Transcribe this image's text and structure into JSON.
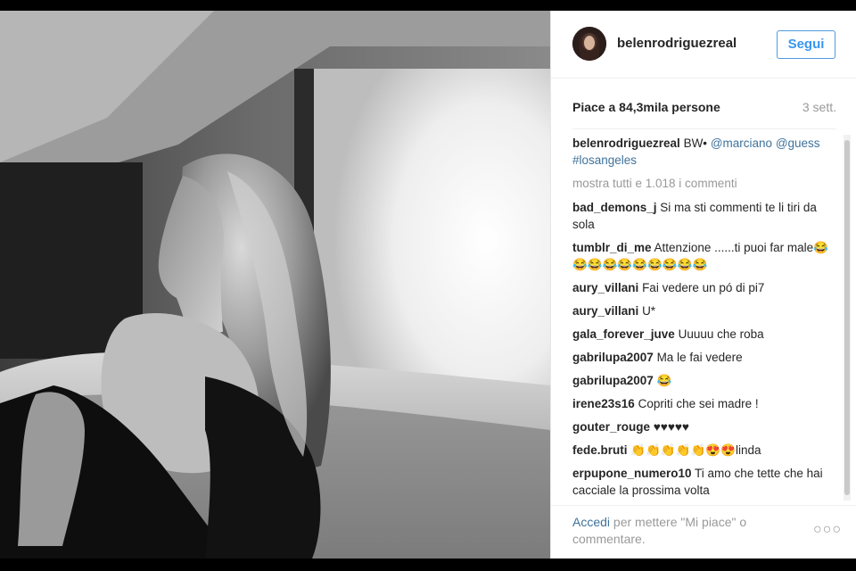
{
  "post": {
    "username": "belenrodriguezreal",
    "follow_label": "Segui",
    "likes": "Piace a 84,3mila persone",
    "time_ago": "3 sett.",
    "caption": {
      "user": "belenrodriguezreal",
      "text": "BW•",
      "tags": [
        "@marciano",
        "@guess",
        "#losangeles"
      ]
    },
    "show_all": "mostra tutti e 1.018 i commenti",
    "comments": [
      {
        "user": "bad_demons_j",
        "text": "Si ma sti commenti te li tiri da sola"
      },
      {
        "user": "tumblr_di_me",
        "text": "Attenzione ......ti puoi far male😂😂😂😂😂😂😂😂😂😂"
      },
      {
        "user": "aury_villani",
        "text": "Fai vedere un pó di pi7"
      },
      {
        "user": "aury_villani",
        "text": "U*"
      },
      {
        "user": "gala_forever_juve",
        "text": "Uuuuu che roba"
      },
      {
        "user": "gabrilupa2007",
        "text": "Ma le fai vedere"
      },
      {
        "user": "gabrilupa2007",
        "text": "😂"
      },
      {
        "user": "irene23s16",
        "text": "Copriti che sei madre !"
      },
      {
        "user": "gouter_rouge",
        "text": "♥♥♥♥♥"
      },
      {
        "user": "fede.bruti",
        "text": "👏👏👏👏👏😍😍linda"
      },
      {
        "user": "erpupone_numero10",
        "text": "Ti amo che tette che hai cacciale la prossima volta"
      }
    ],
    "footer": {
      "login_link": "Accedi",
      "login_text": "per mettere \"Mi piace\" o commentare.",
      "more_icon": "ellipsis-icon"
    }
  },
  "colors": {
    "link": "#3f729b",
    "follow": "#3897f0",
    "muted": "#999999",
    "text": "#262626"
  }
}
